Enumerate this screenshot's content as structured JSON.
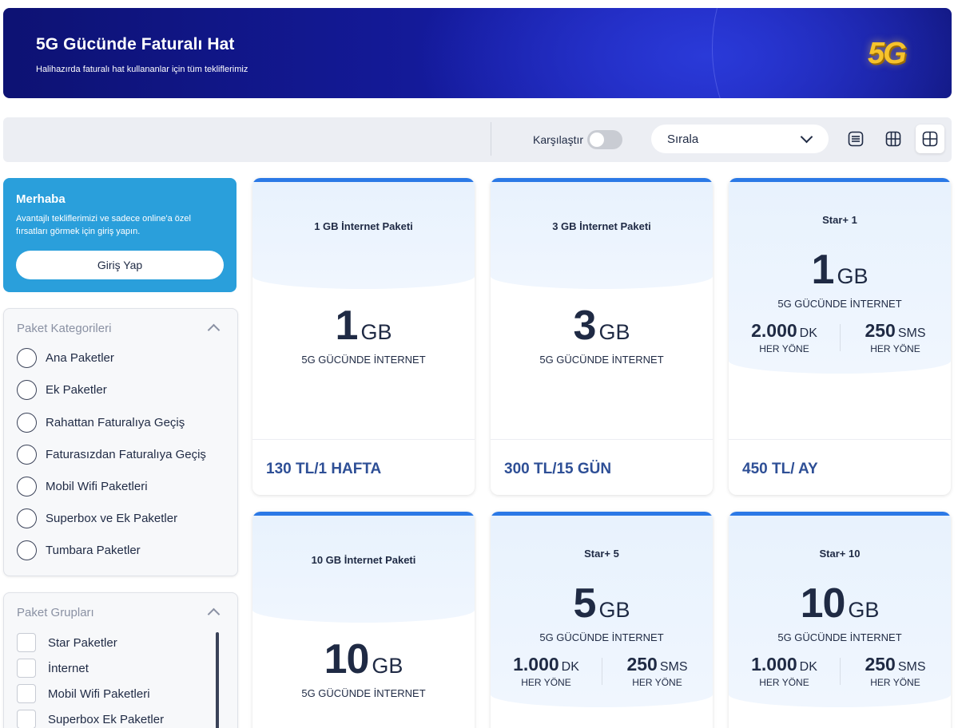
{
  "banner": {
    "title": "5G Gücünde Faturalı Hat",
    "subtitle": "Halihazırda faturalı hat kullananlar için tüm tekliflerimiz",
    "badge": "5G"
  },
  "toolbar": {
    "compare_label": "Karşılaştır",
    "compare_enabled": false,
    "sort_label": "Sırala",
    "view_modes": [
      "list-view-icon",
      "grid-view-icon",
      "tile-view-icon"
    ],
    "active_view": "tile-view-icon"
  },
  "login": {
    "title": "Merhaba",
    "text": "Avantajlı tekliflerimizi ve sadece online'a özel fırsatları görmek için giriş yapın.",
    "button": "Giriş Yap"
  },
  "categories": {
    "title": "Paket Kategorileri",
    "items": [
      {
        "label": "Ana Paketler"
      },
      {
        "label": "Ek Paketler"
      },
      {
        "label": "Rahattan Faturalıya Geçiş"
      },
      {
        "label": "Faturasızdan Faturalıya Geçiş"
      },
      {
        "label": "Mobil Wifi Paketleri"
      },
      {
        "label": "Superbox ve Ek Paketler"
      },
      {
        "label": "Tumbara Paketler"
      }
    ]
  },
  "groups": {
    "title": "Paket Grupları",
    "items": [
      {
        "label": "Star Paketler"
      },
      {
        "label": "İnternet"
      },
      {
        "label": "Mobil Wifi Paketleri"
      },
      {
        "label": "Superbox Ek Paketler"
      }
    ]
  },
  "cards": [
    {
      "name": "1 GB İnternet Paketi",
      "gb": "1",
      "gb_unit": "GB",
      "gb_sub": "5G GÜCÜNDE İNTERNET",
      "price": "130 TL/1 HAFTA"
    },
    {
      "name": "3 GB İnternet Paketi",
      "gb": "3",
      "gb_unit": "GB",
      "gb_sub": "5G GÜCÜNDE İNTERNET",
      "price": "300 TL/15 GÜN"
    },
    {
      "name": "Star+ 1",
      "gb": "1",
      "gb_unit": "GB",
      "gb_sub": "5G GÜCÜNDE İNTERNET",
      "minutes": "2.000",
      "minutes_unit": "DK",
      "minutes_sub": "HER YÖNE",
      "sms": "250",
      "sms_unit": "SMS",
      "sms_sub": "HER YÖNE",
      "price": "450 TL/ AY"
    },
    {
      "name": "10 GB İnternet Paketi",
      "gb": "10",
      "gb_unit": "GB",
      "gb_sub": "5G GÜCÜNDE İNTERNET"
    },
    {
      "name": "Star+ 5",
      "gb": "5",
      "gb_unit": "GB",
      "gb_sub": "5G GÜCÜNDE İNTERNET",
      "minutes": "1.000",
      "minutes_unit": "DK",
      "minutes_sub": "HER YÖNE",
      "sms": "250",
      "sms_unit": "SMS",
      "sms_sub": "HER YÖNE"
    },
    {
      "name": "Star+ 10",
      "gb": "10",
      "gb_unit": "GB",
      "gb_sub": "5G GÜCÜNDE İNTERNET",
      "minutes": "1.000",
      "minutes_unit": "DK",
      "minutes_sub": "HER YÖNE",
      "sms": "250",
      "sms_unit": "SMS",
      "sms_sub": "HER YÖNE"
    }
  ],
  "colors": {
    "banner_dark": "#0d1273",
    "login_blue": "#2a9fdb",
    "card_accent": "#2b79e6",
    "price_blue": "#2e4f96"
  }
}
